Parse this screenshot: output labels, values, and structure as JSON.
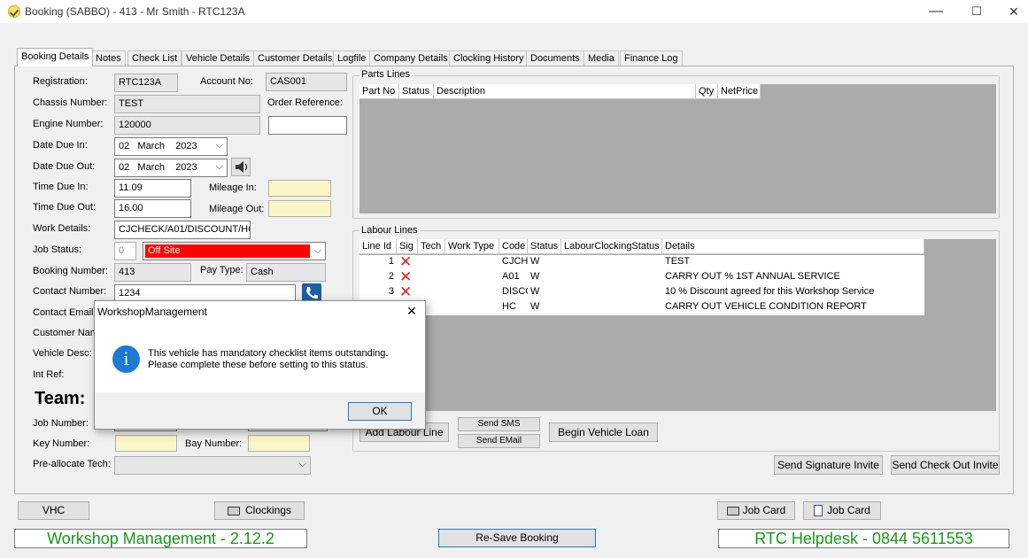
{
  "window": {
    "title": "Booking (SABBO) - 413 - Mr Smith - RTC123A",
    "minimize": "—",
    "maximize": "☐",
    "close": "✕"
  },
  "tabs": [
    "Booking Details",
    "Notes",
    "Check List",
    "Vehicle Details",
    "Customer Details",
    "Logfile",
    "Company Details",
    "Clocking History",
    "Documents",
    "Media",
    "Finance Log"
  ],
  "form": {
    "registration_label": "Registration:",
    "registration": "RTC123A",
    "account_label": "Account No:",
    "account": "CAS001",
    "chassis_label": "Chassis Number:",
    "chassis": "TEST",
    "order_ref_label": "Order Reference:",
    "order_ref": "",
    "engine_label": "Engine Number:",
    "engine": "120000",
    "date_due_in_label": "Date Due In:",
    "date_due_in": "02   March    2023",
    "date_due_out_label": "Date Due Out:",
    "date_due_out": "02   March    2023",
    "time_due_in_label": "Time Due In:",
    "time_due_in": "11.09",
    "mileage_in_label": "Mileage In:",
    "time_due_out_label": "Time Due Out:",
    "time_due_out": "16.00",
    "mileage_out_label": "Mileage Out:",
    "work_details_label": "Work Details:",
    "work_details": "CJCHECK/A01/DISCOUNT/HC",
    "job_status_label": "Job Status:",
    "job_status_code": "0",
    "job_status": "Off Site",
    "booking_number_label": "Booking Number:",
    "booking_number": "413",
    "pay_type_label": "Pay Type:",
    "pay_type": "Cash",
    "contact_number_label": "Contact Number:",
    "contact_number": "1234",
    "contact_email_label": "Contact Email:",
    "customer_name_label": "Customer Name:",
    "vehicle_desc_label": "Vehicle Desc:",
    "int_ref_label": "Int Ref:",
    "team_label": "Team:",
    "job_number_label": "Job Number:",
    "key_number_label": "Key Number:",
    "bay_number_label": "Bay Number:",
    "preallocate_label": "Pre-allocate Tech:",
    "status_color": "#ff0000"
  },
  "parts": {
    "title": "Parts Lines",
    "columns": [
      "Part No",
      "Status",
      "Description",
      "Qty",
      "NetPrice"
    ]
  },
  "labour": {
    "title": "Labour Lines",
    "columns": [
      "Line Id",
      "Sig",
      "Tech",
      "Work Type",
      "Code",
      "Status",
      "LabourClockingStatus",
      "Details"
    ],
    "rows": [
      {
        "id": "1",
        "code": "CJCH",
        "status": "W",
        "details": "TEST"
      },
      {
        "id": "2",
        "code": "A01",
        "status": "W",
        "details": "CARRY OUT % 1ST ANNUAL SERVICE"
      },
      {
        "id": "3",
        "code": "DISCC",
        "status": "W",
        "details": "10 % Discount agreed for this Workshop Service"
      },
      {
        "id": "",
        "code": "HC",
        "status": "W",
        "details": "CARRY OUT VEHICLE CONDITION REPORT"
      }
    ]
  },
  "buttons": {
    "add_labour": "Add Labour Line",
    "send_sms": "Send SMS",
    "send_email": "Send EMail",
    "begin_loan": "Begin Vehicle Loan",
    "send_signature": "Send Signature Invite",
    "send_checkout": "Send Check Out Invite",
    "vhc": "VHC",
    "clockings": "Clockings",
    "job_card_print": "Job Card",
    "job_card_preview": "Job Card",
    "resave": "Re-Save Booking"
  },
  "footer": {
    "left": "Workshop Management - 2.12.2",
    "right": "RTC Helpdesk - 0844 5611553"
  },
  "dialog": {
    "title": "WorkshopManagement",
    "close": "✕",
    "message_line1": "This vehicle has mandatory checklist items outstanding.",
    "message_line2": "Please complete these before setting to this status.",
    "ok": "OK"
  },
  "icons": {
    "app": "app-logo-icon",
    "speaker": "speaker-icon",
    "phone": "phone-icon",
    "printer": "printer-icon",
    "preview": "print-preview-icon",
    "info": "info-icon",
    "delete": "x-mark-icon"
  }
}
